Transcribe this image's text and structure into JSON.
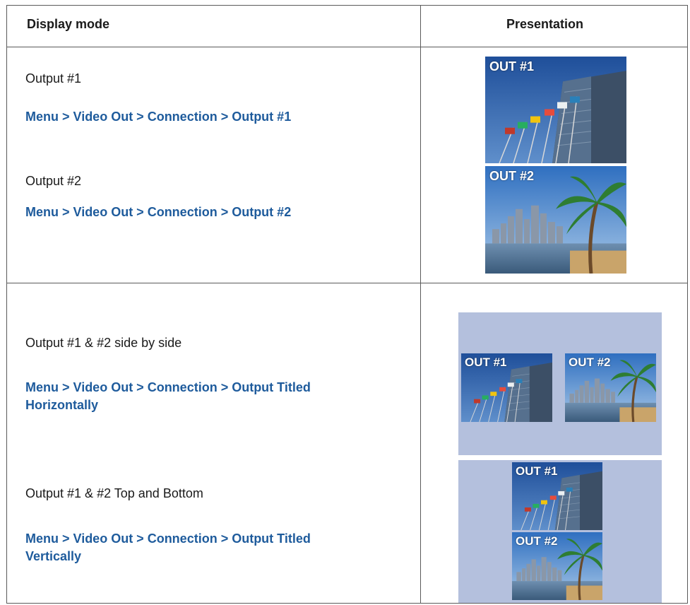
{
  "table": {
    "headers": {
      "col1": "Display mode",
      "col2": "Presentation"
    },
    "rows": [
      {
        "modes": [
          {
            "title": "Output #1",
            "menu": "Menu > Video Out > Connection > Output #1"
          },
          {
            "title": "Output #2",
            "menu": "Menu > Video Out > Connection > Output #2"
          }
        ]
      },
      {
        "modes": [
          {
            "title": "Output #1 & #2 side by side",
            "menu_line1": "Menu > Video Out > Connection > Output Titled",
            "menu_line2": "Horizontally"
          },
          {
            "title": "Output #1 & #2 Top and Bottom",
            "menu_line1": "Menu > Video Out > Connection > Output Titled",
            "menu_line2": "Vertically"
          }
        ]
      }
    ]
  },
  "image_labels": {
    "out1": "OUT #1",
    "out2": "OUT #2"
  },
  "colors": {
    "menu_text": "#1e5b9c",
    "panel_bg": "#b4c0dd",
    "border": "#5a5a5a"
  }
}
